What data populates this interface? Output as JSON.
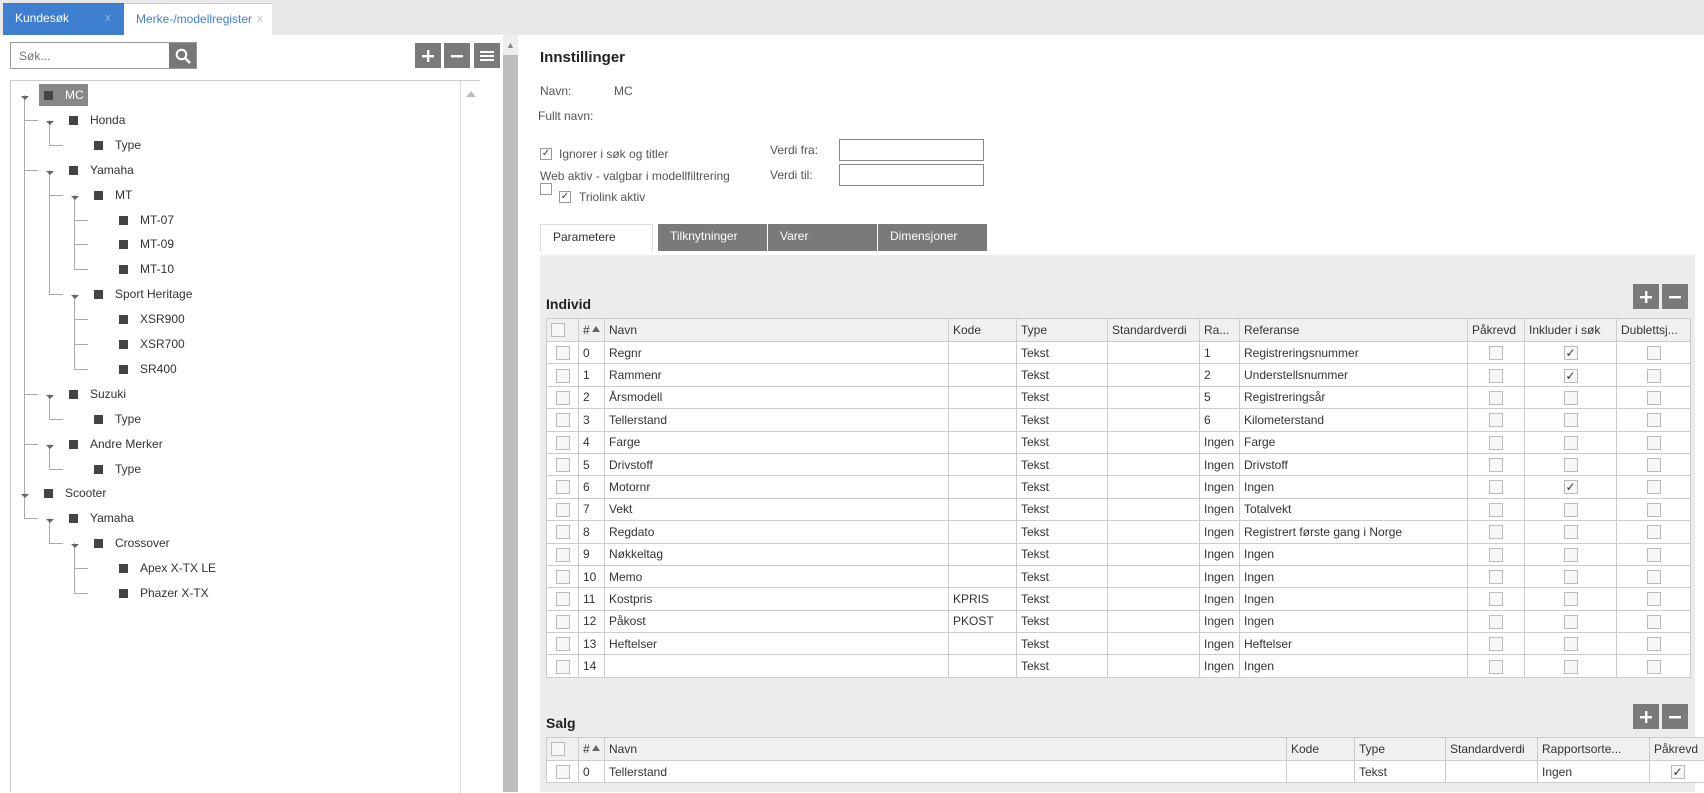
{
  "tabs": [
    {
      "label": "Kundesøk",
      "close": "x"
    },
    {
      "label": "Merke-/modellregister",
      "close": "x"
    }
  ],
  "search": {
    "placeholder": "Søk..."
  },
  "tree": [
    {
      "label": "MC",
      "selected": true
    },
    {
      "label": "Honda"
    },
    {
      "label": "Type"
    },
    {
      "label": "Yamaha"
    },
    {
      "label": "MT"
    },
    {
      "label": "MT-07"
    },
    {
      "label": "MT-09"
    },
    {
      "label": "MT-10"
    },
    {
      "label": "Sport Heritage"
    },
    {
      "label": "XSR900"
    },
    {
      "label": "XSR700"
    },
    {
      "label": "SR400"
    },
    {
      "label": "Suzuki"
    },
    {
      "label": "Type"
    },
    {
      "label": "Andre Merker"
    },
    {
      "label": "Type"
    },
    {
      "label": "Scooter"
    },
    {
      "label": "Yamaha"
    },
    {
      "label": "Crossover"
    },
    {
      "label": "Apex X-TX LE"
    },
    {
      "label": "Phazer X-TX"
    }
  ],
  "settings": {
    "title": "Innstillinger",
    "name_label": "Navn:",
    "name_value": "MC",
    "fullname_label": "Fullt navn:",
    "ignore_label": "Ignorer i søk og titler",
    "ignore_checked": true,
    "web_label": "Web aktiv - valgbar i modellfiltrering",
    "web_checked": false,
    "triolink_label": "Triolink aktiv",
    "triolink_checked": true,
    "from_label": "Verdi fra:",
    "to_label": "Verdi til:",
    "from_value": "",
    "to_value": ""
  },
  "param_tabs": [
    {
      "label": "Parametere",
      "active": true
    },
    {
      "label": "Tilknytninger",
      "active": false
    },
    {
      "label": "Varer",
      "active": false
    },
    {
      "label": "Dimensjoner",
      "active": false
    }
  ],
  "individ": {
    "title": "Individ",
    "headers": [
      "#",
      "Navn",
      "Kode",
      "Type",
      "Standardverdi",
      "Ra...",
      "Referanse",
      "Påkrevd",
      "Inkluder i søk",
      "Dublettsj..."
    ],
    "rows": [
      {
        "n": "0",
        "navn": "Regnr",
        "kode": "",
        "type": "Tekst",
        "std": "",
        "ra": "1",
        "ref": "Registreringsnummer",
        "pak": false,
        "ink": true,
        "dub": false
      },
      {
        "n": "1",
        "navn": "Rammenr",
        "kode": "",
        "type": "Tekst",
        "std": "",
        "ra": "2",
        "ref": "Understellsnummer",
        "pak": false,
        "ink": true,
        "dub": false
      },
      {
        "n": "2",
        "navn": "Årsmodell",
        "kode": "",
        "type": "Tekst",
        "std": "",
        "ra": "5",
        "ref": "Registreringsår",
        "pak": false,
        "ink": false,
        "dub": false
      },
      {
        "n": "3",
        "navn": "Tellerstand",
        "kode": "",
        "type": "Tekst",
        "std": "",
        "ra": "6",
        "ref": "Kilometerstand",
        "pak": false,
        "ink": false,
        "dub": false
      },
      {
        "n": "4",
        "navn": "Farge",
        "kode": "",
        "type": "Tekst",
        "std": "",
        "ra": "Ingen",
        "ref": "Farge",
        "pak": false,
        "ink": false,
        "dub": false
      },
      {
        "n": "5",
        "navn": "Drivstoff",
        "kode": "",
        "type": "Tekst",
        "std": "",
        "ra": "Ingen",
        "ref": "Drivstoff",
        "pak": false,
        "ink": false,
        "dub": false
      },
      {
        "n": "6",
        "navn": "Motornr",
        "kode": "",
        "type": "Tekst",
        "std": "",
        "ra": "Ingen",
        "ref": "Ingen",
        "pak": false,
        "ink": true,
        "dub": false
      },
      {
        "n": "7",
        "navn": "Vekt",
        "kode": "",
        "type": "Tekst",
        "std": "",
        "ra": "Ingen",
        "ref": "Totalvekt",
        "pak": false,
        "ink": false,
        "dub": false
      },
      {
        "n": "8",
        "navn": "Regdato",
        "kode": "",
        "type": "Tekst",
        "std": "",
        "ra": "Ingen",
        "ref": "Registrert første gang i Norge",
        "pak": false,
        "ink": false,
        "dub": false
      },
      {
        "n": "9",
        "navn": "Nøkkeltag",
        "kode": "",
        "type": "Tekst",
        "std": "",
        "ra": "Ingen",
        "ref": "Ingen",
        "pak": false,
        "ink": false,
        "dub": false
      },
      {
        "n": "10",
        "navn": "Memo",
        "kode": "",
        "type": "Tekst",
        "std": "",
        "ra": "Ingen",
        "ref": "Ingen",
        "pak": false,
        "ink": false,
        "dub": false
      },
      {
        "n": "11",
        "navn": "Kostpris",
        "kode": "KPRIS",
        "type": "Tekst",
        "std": "",
        "ra": "Ingen",
        "ref": "Ingen",
        "pak": false,
        "ink": false,
        "dub": false
      },
      {
        "n": "12",
        "navn": "Påkost",
        "kode": "PKOST",
        "type": "Tekst",
        "std": "",
        "ra": "Ingen",
        "ref": "Ingen",
        "pak": false,
        "ink": false,
        "dub": false
      },
      {
        "n": "13",
        "navn": "Heftelser",
        "kode": "",
        "type": "Tekst",
        "std": "",
        "ra": "Ingen",
        "ref": "Heftelser",
        "pak": false,
        "ink": false,
        "dub": false
      },
      {
        "n": "14",
        "navn": "",
        "kode": "",
        "type": "Tekst",
        "std": "",
        "ra": "Ingen",
        "ref": "Ingen",
        "pak": false,
        "ink": false,
        "dub": false
      }
    ]
  },
  "salg": {
    "title": "Salg",
    "headers": [
      "#",
      "Navn",
      "Kode",
      "Type",
      "Standardverdi",
      "Rapportsorte...",
      "Påkrevd"
    ],
    "rows": [
      {
        "n": "0",
        "navn": "Tellerstand",
        "kode": "",
        "type": "Tekst",
        "std": "",
        "rap": "Ingen",
        "pak": true
      }
    ]
  },
  "icons": {
    "check": "✓",
    "plus": "+",
    "minus": "−"
  }
}
